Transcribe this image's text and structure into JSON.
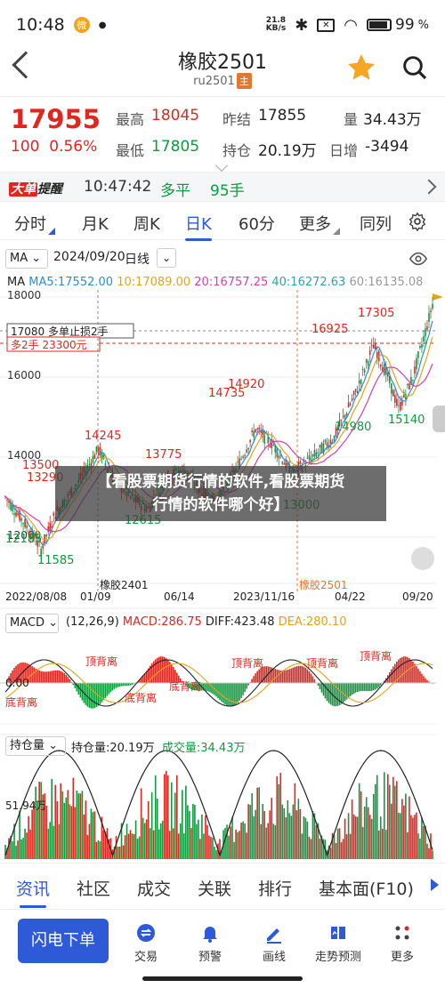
{
  "status": {
    "time": "10:48",
    "speed_top": "21.8",
    "speed_bottom": "KB/s",
    "battery": "99"
  },
  "header": {
    "title": "橡胶2501",
    "code": "ru2501",
    "badge": "主"
  },
  "quote": {
    "price": "17955",
    "change": "100",
    "change_pct": "0.56%",
    "high_label": "最高",
    "high": "18045",
    "low_label": "最低",
    "low": "17805",
    "prev_label": "昨结",
    "prev": "17855",
    "oi_label": "持仓",
    "oi": "20.19万",
    "vol_label": "量",
    "vol": "34.43万",
    "daychg_label": "日增",
    "daychg": "-3494"
  },
  "ticker": {
    "tag_a": "大单",
    "tag_b": "提醒",
    "time": "10:47:42",
    "type": "多平",
    "volume": "95手"
  },
  "periods": [
    "分时",
    "月K",
    "周K",
    "日K",
    "60分",
    "更多",
    "同列"
  ],
  "chart": {
    "indicator": "MA",
    "date": "2024/09/20",
    "kind": "日线",
    "ma5": "MA5:17552.00",
    "ma10": "10:17089.00",
    "ma20": "20:16757.25",
    "ma40": "40:16272.63",
    "ma60": "60:16135.08",
    "y_labels": [
      "18000",
      "16000",
      "14000",
      "12000"
    ],
    "order_line": "17080 多单止损2手",
    "order_box": "多2手 23300元",
    "price_labels": [
      "17305",
      "16925",
      "14920",
      "14735",
      "14245",
      "13775",
      "13500",
      "13290",
      "12185",
      "11585",
      "12615",
      "13000",
      "14980",
      "15140"
    ],
    "contracts": [
      "橡胶2401",
      "橡胶2501"
    ],
    "dates": [
      "2022/08/08",
      "01/09",
      "06/14",
      "2023/11/16",
      "04/22",
      "09/20"
    ]
  },
  "macd": {
    "label": "MACD",
    "params": "(12,26,9)",
    "macd": "MACD:286.75",
    "diff": "DIFF:423.48",
    "dea": "DEA:280.10",
    "zero": "0.00",
    "labels": [
      "顶背离",
      "顶背离",
      "顶背离",
      "顶背离",
      "底背离",
      "底背离",
      "底背离"
    ]
  },
  "openint": {
    "label": "持仓量",
    "oi": "持仓量:20.19万",
    "vol": "成交量:34.43万",
    "axis": "51.94万"
  },
  "banner": {
    "line1": "【看股票期货行情的软件,看股票期货",
    "line2": "行情的软件哪个好】"
  },
  "content_tabs": [
    "资讯",
    "社区",
    "成交",
    "关联",
    "排行",
    "基本面(F10)"
  ],
  "actions": {
    "flash": "闪电下单",
    "items": [
      "交易",
      "预警",
      "画线",
      "走势预测",
      "更多"
    ]
  },
  "colors": {
    "up": "#e0261f",
    "down": "#0f9a3e",
    "accent": "#2e5ad7"
  }
}
